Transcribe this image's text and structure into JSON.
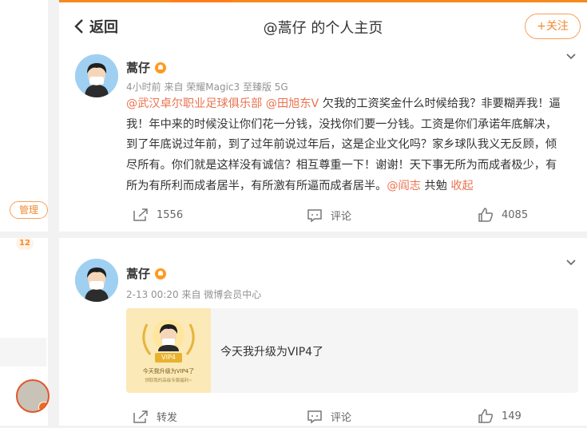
{
  "header": {
    "back_label": "返回",
    "title": "@蒿仔 的个人主页",
    "follow_label": "+关注"
  },
  "sidebar": {
    "manage_label": "管理",
    "count_badge": "12"
  },
  "posts": [
    {
      "username": "蒿仔",
      "meta": "4小时前 来自 荣耀Magic3 至臻版 5G",
      "content": {
        "mention1": "@武汉卓尔职业足球俱乐部",
        "mention2": "@田旭东V",
        "text": " 欠我的工资奖金什么时候给我？非要糊弄我！逼我！年中来的时候没让你们花一分钱，没找你们要一分钱。工资是你们承诺年底解决，到了年底说过年前，到了过年前说过年后，这是企业文化吗？家乡球队我义无反顾，倾尽所有。你们就是这样没有诚信？相互尊重一下！谢谢！天下事无所为而成者极少，有所为有所利而成者居半，有所激有所逼而成者居半。",
        "mention3": "@阎志",
        "tail": " 共勉 ",
        "collapse": "收起"
      },
      "actions": {
        "repost": "1556",
        "comment": "评论",
        "like": "4085"
      }
    },
    {
      "username": "蒿仔",
      "meta": "2-13 00:20 来自 微博会员中心",
      "share": {
        "text": "今天我升级为VIP4了",
        "vip_tag": "VIP4",
        "caption": "今天我升级为VIP4了",
        "sub_caption": "领取我的高级专属福利~"
      },
      "actions": {
        "repost": "转发",
        "comment": "评论",
        "like": "149"
      }
    }
  ],
  "colors": {
    "accent": "#ff8200",
    "link": "#eb7350"
  }
}
